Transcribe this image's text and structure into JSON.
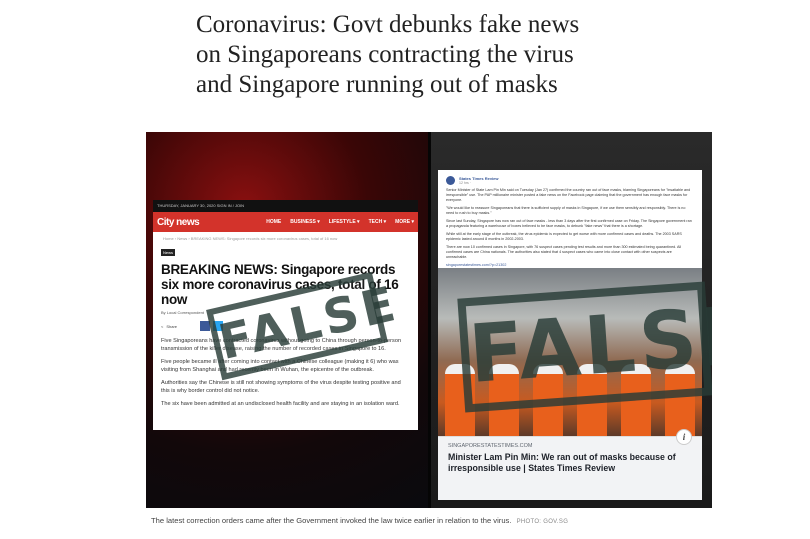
{
  "article": {
    "headline_line1": "Coronavirus: Govt debunks fake news",
    "headline_line2": "on Singaporeans contracting the virus",
    "headline_line3": "and Singapore running out of masks"
  },
  "left_screenshot": {
    "topbar": "THURSDAY, JANUARY 30, 2020     SIGN IN / JOIN",
    "logo": "City news",
    "nav": [
      "HOME",
      "BUSINESS ▾",
      "LIFESTYLE ▾",
      "TECH ▾",
      "MORE ▾"
    ],
    "breadcrumb": "Home › News › BREAKING NEWS: Singapore records six more coronavirus cases, total of 16 now",
    "tag": "News",
    "title": "BREAKING NEWS: Singapore records six more coronavirus cases, total of 16 now",
    "byline": "By Local Correspondent",
    "share_label": "Share",
    "paragraphs": [
      "Five Singaporeans have contracted coronavirus without going to China through person-to-person transmission of the killer disease, raising the number of recorded cases in Singapore to 16.",
      "Five people became ill after coming into contact with a Chinese colleague (making it 6) who was visiting from Shanghai and had recently been in Wuhan, the epicentre of the outbreak.",
      "Authorities say the Chinese is still not showing symptoms of the virus despite testing positive and this is why border control did not notice.",
      "The six have been admitted at an undisclosed health facility and are staying in an isolation ward."
    ],
    "stamp": "FALSE"
  },
  "right_screenshot": {
    "page_name": "States Times Review",
    "post_time": "12 hrs · ",
    "post_paragraphs": [
      "Senior Minister of State Lam Pin Min said on Tuesday (Jan 27) confirmed the country ran out of face masks, blaming Singaporeans for \"insatiable and irresponsible\" use. The PAP millionaire minister posted a fake news on the Facebook page claiming that the government has enough face masks for everyone.",
      "\"We would like to reassure Singaporeans that there is sufficient supply of masks in Singapore, if we use them sensibly and responsibly. There is no need to rush to buy masks.\"",
      "Since last Sunday, Singapore has now ran out of face masks - less than 3 days after the first confirmed case on Friday. The Singapore government ran a propaganda featuring a warehouse of boxes believed to be face masks, to debunk \"fake news\" that there is a shortage.",
      "While still at the early stage of the outbreak, the virus epidemic is expected to get worse with more confirmed cases and deaths. The 2003 SARS epidemic lasted around 8 months in 2002-2003.",
      "There are now 10 confirmed cases in Singapore, with 76 suspect cases pending test results and more than 300 estimated being quarantined. All confirmed cases are China nationals. The authorities also stated that 4 suspect cases who came into close contact with other suspects are unreachable.",
      "singaporestatestimes.com/?p=21302"
    ],
    "link_domain": "SINGAPORESTATESTIMES.COM",
    "link_title": "Minister Lam Pin Min: We ran out of masks because of irresponsible use | States Times Review",
    "info_glyph": "i",
    "stamp": "FALSE"
  },
  "caption": {
    "text": "The latest correction orders came after the Government invoked the law twice earlier in relation to the virus.",
    "credit": "PHOTO: GOV.SG"
  }
}
